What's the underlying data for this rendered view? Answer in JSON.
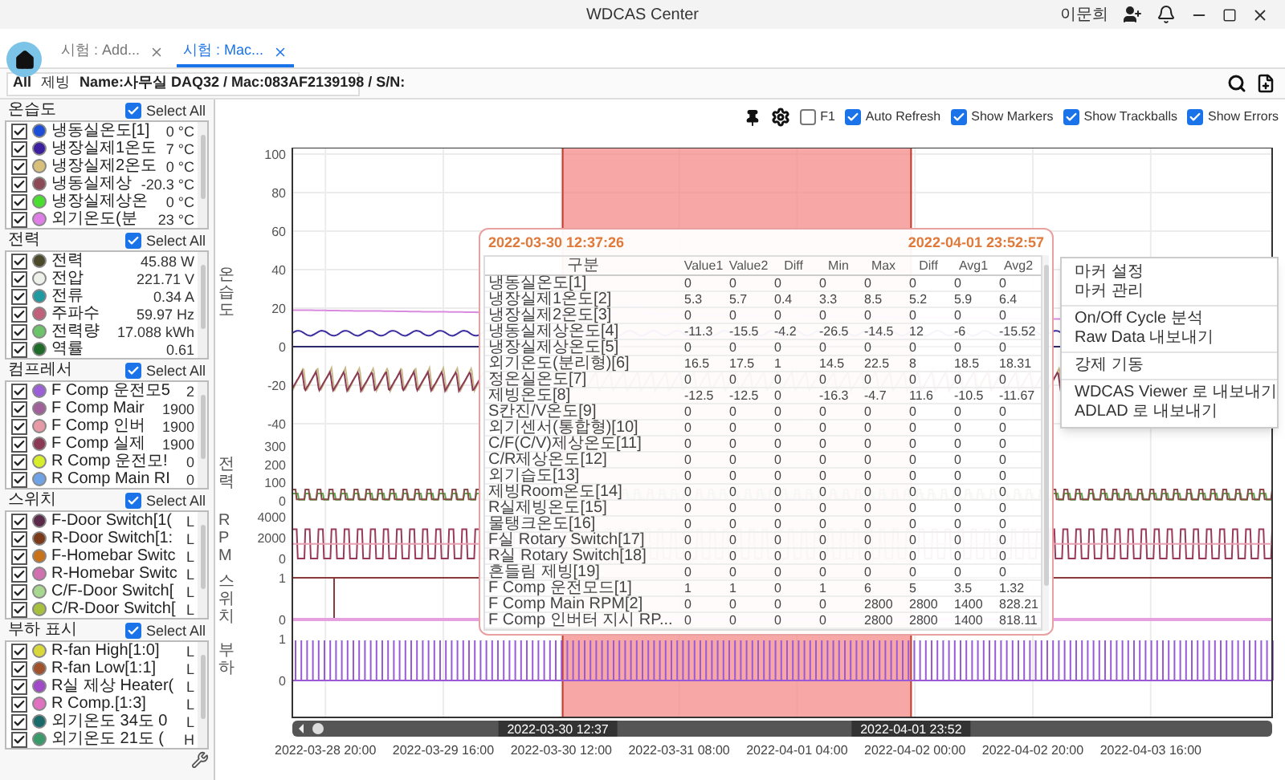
{
  "window": {
    "title": "WDCAS Center",
    "user": "이문희"
  },
  "tabs": [
    {
      "label": "시험 : Add...",
      "selected": false
    },
    {
      "label": "시험 : Mac...",
      "selected": true
    }
  ],
  "breadcrumb": [
    "All",
    "제빙",
    "Name:사무실 DAQ32 / Mac:083AF2139198 / S/N:"
  ],
  "sidebar": {
    "groups": [
      {
        "title": "온습도",
        "select_all": {
          "label": "Select All",
          "checked": true
        },
        "items": [
          {
            "name": "냉동실온도[1]",
            "value": "0 °C",
            "color": "#1d4ed8",
            "checked": true
          },
          {
            "name": "냉장실제1온도",
            "value": "7 °C",
            "color": "#3b1f9e",
            "checked": true
          },
          {
            "name": "냉장실제2온도",
            "value": "0 °C",
            "color": "#d8c07a",
            "checked": true
          },
          {
            "name": "냉동실제상",
            "value": "-20.3 °C",
            "color": "#8b4a55",
            "checked": true
          },
          {
            "name": "냉장실제상온",
            "value": "0 °C",
            "color": "#4ade30",
            "checked": true
          },
          {
            "name": "외기온도(분",
            "value": "23 °C",
            "color": "#e07ee8",
            "checked": true
          }
        ]
      },
      {
        "title": "전력",
        "select_all": {
          "label": "Select All",
          "checked": true
        },
        "items": [
          {
            "name": "전력",
            "value": "45.88 W",
            "color": "#4a4a2a",
            "checked": true
          },
          {
            "name": "전압",
            "value": "221.71 V",
            "color": "#eef0ea",
            "checked": true
          },
          {
            "name": "전류",
            "value": "0.34 A",
            "color": "#1f9aa0",
            "checked": true
          },
          {
            "name": "주파수",
            "value": "59.97 Hz",
            "color": "#c0607a",
            "checked": true
          },
          {
            "name": "전력량",
            "value": "17.088 kWh",
            "color": "#6cc36a",
            "checked": true
          },
          {
            "name": "역률",
            "value": "0.61",
            "color": "#1e6b2a",
            "checked": true
          }
        ]
      },
      {
        "title": "컴프레서",
        "select_all": {
          "label": "Select All",
          "checked": true
        },
        "items": [
          {
            "name": "F Comp 운전모5",
            "value": "2",
            "color": "#9b5fd6",
            "checked": true
          },
          {
            "name": "F Comp Mair",
            "value": "1900",
            "color": "#a0609a",
            "checked": true
          },
          {
            "name": "F Comp 인버",
            "value": "1900",
            "color": "#e79aa6",
            "checked": true
          },
          {
            "name": "F Comp 실제",
            "value": "1900",
            "color": "#8b3a55",
            "checked": true
          },
          {
            "name": "R Comp 운전모!",
            "value": "0",
            "color": "#d7ee2a",
            "checked": true
          },
          {
            "name": "R Comp Main RI",
            "value": "0",
            "color": "#6fa3e6",
            "checked": true
          }
        ]
      },
      {
        "title": "스위치",
        "select_all": {
          "label": "Select All",
          "checked": true
        },
        "items": [
          {
            "name": "F-Door Switch[1(",
            "value": "L",
            "color": "#5a2a4a",
            "checked": true
          },
          {
            "name": "R-Door Switch[1:",
            "value": "L",
            "color": "#7a3a1a",
            "checked": true
          },
          {
            "name": "F-Homebar Switc",
            "value": "L",
            "color": "#c8731a",
            "checked": true
          },
          {
            "name": "R-Homebar Switc",
            "value": "L",
            "color": "#d070b0",
            "checked": true
          },
          {
            "name": "C/F-Door Switch[",
            "value": "L",
            "color": "#a8d890",
            "checked": true
          },
          {
            "name": "C/R-Door Switch[",
            "value": "L",
            "color": "#a8c040",
            "checked": true
          }
        ]
      },
      {
        "title": "부하 표시",
        "select_all": {
          "label": "Select All",
          "checked": true
        },
        "items": [
          {
            "name": "R-fan High[1:0]",
            "value": "L",
            "color": "#d8d83a",
            "checked": true
          },
          {
            "name": "R-fan Low[1:1]",
            "value": "L",
            "color": "#a0522d",
            "checked": true
          },
          {
            "name": "R실 제상 Heater(",
            "value": "L",
            "color": "#a04ac8",
            "checked": true
          },
          {
            "name": "R Comp.[1:3]",
            "value": "L",
            "color": "#e070c0",
            "checked": true
          },
          {
            "name": "외기온도 34도 0",
            "value": "L",
            "color": "#1a6a6a",
            "checked": true
          },
          {
            "name": "외기온도 21도 (",
            "value": "H",
            "color": "#3a9a6a",
            "checked": true
          }
        ]
      }
    ]
  },
  "toolbar": {
    "options": [
      {
        "label": "F1",
        "checked": false
      },
      {
        "label": "Auto Refresh",
        "checked": true
      },
      {
        "label": "Show Markers",
        "checked": true
      },
      {
        "label": "Show Trackballs",
        "checked": true
      },
      {
        "label": "Show Errors",
        "checked": true
      }
    ]
  },
  "chart": {
    "axes": [
      {
        "title": "온습도",
        "ticks": [
          "100",
          "80",
          "60",
          "40",
          "20",
          "0",
          "-20",
          "-40"
        ]
      },
      {
        "title": "전력",
        "ticks": [
          "300",
          "200",
          "100",
          "0"
        ]
      },
      {
        "title": "RPM",
        "ticks": [
          "4000",
          "2000",
          "0"
        ]
      },
      {
        "title": "스위치",
        "ticks": [
          "1",
          "0"
        ]
      },
      {
        "title": "부하",
        "ticks": [
          "1",
          "0"
        ]
      }
    ],
    "x_ticks": [
      "2022-03-28 20:00",
      "2022-03-29 16:00",
      "2022-03-30 12:00",
      "2022-03-31 08:00",
      "2022-04-01 04:00",
      "2022-04-02 00:00",
      "2022-04-02 20:00",
      "2022-04-03 16:00"
    ],
    "range": {
      "start": "2022-03-30 12:37",
      "end": "2022-04-01 23:52"
    }
  },
  "tooltip": {
    "start": "2022-03-30 12:37:26",
    "end": "2022-04-01 23:52:57",
    "columns": [
      "구분",
      "Value1",
      "Value2",
      "Diff",
      "Min",
      "Max",
      "Diff",
      "Avg1",
      "Avg2"
    ],
    "rows": [
      {
        "label": "냉동실온도[1]",
        "values": [
          "0",
          "0",
          "0",
          "0",
          "0",
          "0",
          "0",
          "0"
        ]
      },
      {
        "label": "냉장실제1온도[2]",
        "values": [
          "5.3",
          "5.7",
          "0.4",
          "3.3",
          "8.5",
          "5.2",
          "5.9",
          "6.4"
        ]
      },
      {
        "label": "냉장실제2온도[3]",
        "values": [
          "0",
          "0",
          "0",
          "0",
          "0",
          "0",
          "0",
          "0"
        ]
      },
      {
        "label": "냉동실제상온도[4]",
        "values": [
          "-11.3",
          "-15.5",
          "-4.2",
          "-26.5",
          "-14.5",
          "12",
          "-6",
          "-15.52"
        ]
      },
      {
        "label": "냉장실제상온도[5]",
        "values": [
          "0",
          "0",
          "0",
          "0",
          "0",
          "0",
          "0",
          "0"
        ]
      },
      {
        "label": "외기온도(분리형)[6]",
        "values": [
          "16.5",
          "17.5",
          "1",
          "14.5",
          "22.5",
          "8",
          "18.5",
          "18.31"
        ]
      },
      {
        "label": "정온실온도[7]",
        "values": [
          "0",
          "0",
          "0",
          "0",
          "0",
          "0",
          "0",
          "0"
        ]
      },
      {
        "label": "제빙온도[8]",
        "values": [
          "-12.5",
          "-12.5",
          "0",
          "-16.3",
          "-4.7",
          "11.6",
          "-10.5",
          "-11.67"
        ]
      },
      {
        "label": "S칸진/V온도[9]",
        "values": [
          "0",
          "0",
          "0",
          "0",
          "0",
          "0",
          "0",
          "0"
        ]
      },
      {
        "label": "외기센서(통합형)[10]",
        "values": [
          "0",
          "0",
          "0",
          "0",
          "0",
          "0",
          "0",
          "0"
        ]
      },
      {
        "label": "C/F(C/V)제상온도[11]",
        "values": [
          "0",
          "0",
          "0",
          "0",
          "0",
          "0",
          "0",
          "0"
        ]
      },
      {
        "label": "C/R제상온도[12]",
        "values": [
          "0",
          "0",
          "0",
          "0",
          "0",
          "0",
          "0",
          "0"
        ]
      },
      {
        "label": "외기습도[13]",
        "values": [
          "0",
          "0",
          "0",
          "0",
          "0",
          "0",
          "0",
          "0"
        ]
      },
      {
        "label": "제빙Room온도[14]",
        "values": [
          "0",
          "0",
          "0",
          "0",
          "0",
          "0",
          "0",
          "0"
        ]
      },
      {
        "label": "R실제빙온도[15]",
        "values": [
          "0",
          "0",
          "0",
          "0",
          "0",
          "0",
          "0",
          "0"
        ]
      },
      {
        "label": "물탱크온도[16]",
        "values": [
          "0",
          "0",
          "0",
          "0",
          "0",
          "0",
          "0",
          "0"
        ]
      },
      {
        "label": "F실 Rotary Switch[17]",
        "values": [
          "0",
          "0",
          "0",
          "0",
          "0",
          "0",
          "0",
          "0"
        ]
      },
      {
        "label": "R실 Rotary Switch[18]",
        "values": [
          "0",
          "0",
          "0",
          "0",
          "0",
          "0",
          "0",
          "0"
        ]
      },
      {
        "label": "흔들림 제빙[19]",
        "values": [
          "0",
          "0",
          "0",
          "0",
          "0",
          "0",
          "0",
          "0"
        ]
      },
      {
        "label": "F Comp 운전모드[1]",
        "values": [
          "1",
          "1",
          "0",
          "1",
          "6",
          "5",
          "3.5",
          "1.32"
        ]
      },
      {
        "label": "F Comp Main RPM[2]",
        "values": [
          "0",
          "0",
          "0",
          "0",
          "2800",
          "2800",
          "1400",
          "828.21"
        ]
      },
      {
        "label": "F Comp 인버터 지시 RP...",
        "values": [
          "0",
          "0",
          "0",
          "0",
          "2800",
          "2800",
          "1400",
          "818.11"
        ]
      }
    ]
  },
  "context_menu": {
    "sections": [
      {
        "items": [
          "마커 설정",
          "마커 관리"
        ]
      },
      {
        "items": [
          "On/Off Cycle 분석",
          "Raw Data 내보내기"
        ]
      },
      {
        "items": [
          "강제 기동"
        ]
      },
      {
        "items": [
          "WDCAS Viewer 로 내보내기",
          "ADLAD 로 내보내기"
        ]
      }
    ]
  }
}
